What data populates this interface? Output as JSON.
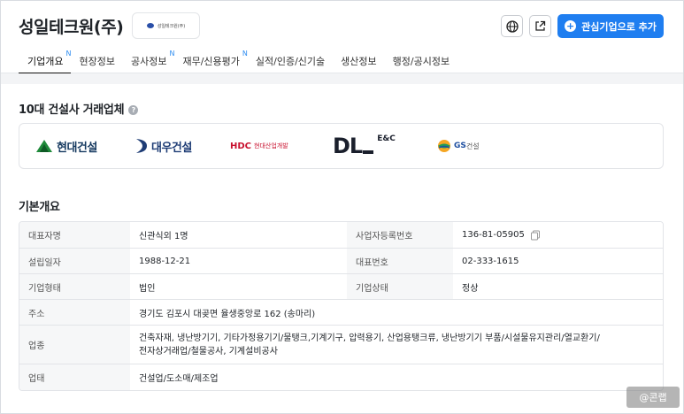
{
  "header": {
    "company_name": "성일테크원(주)",
    "logo_alt_text": "성일테크원(주)",
    "globe_icon": "globe-icon",
    "share_icon": "external-link-icon",
    "interest_button_label": "관심기업으로 추가"
  },
  "tabs": [
    {
      "label": "기업개요",
      "badge": "N",
      "active": true
    },
    {
      "label": "현장정보",
      "badge": "",
      "active": false
    },
    {
      "label": "공사정보",
      "badge": "N",
      "active": false
    },
    {
      "label": "재무/신용평가",
      "badge": "N",
      "active": false
    },
    {
      "label": "실적/인증/신기술",
      "badge": "",
      "active": false
    },
    {
      "label": "생산정보",
      "badge": "",
      "active": false
    },
    {
      "label": "행정/공시정보",
      "badge": "",
      "active": false
    }
  ],
  "partners_section": {
    "title": "10대 건설사 거래업체",
    "partners": [
      {
        "name": "현대건설"
      },
      {
        "name": "대우건설"
      },
      {
        "name": "HDC",
        "sub": "현대산업개발"
      },
      {
        "name": "DL",
        "sub": "E&C"
      },
      {
        "name": "GS",
        "sub": "건설"
      }
    ]
  },
  "overview": {
    "title": "기본개요",
    "rows": [
      {
        "label1": "대표자명",
        "value1": "신관식외 1명",
        "label2": "사업자등록번호",
        "value2": "136-81-05905"
      },
      {
        "label1": "설립일자",
        "value1": "1988-12-21",
        "label2": "대표번호",
        "value2": "02-333-1615"
      },
      {
        "label1": "기업형태",
        "value1": "법인",
        "label2": "기업상태",
        "value2": "정상"
      },
      {
        "label": "주소",
        "value": "경기도 김포시 대곶면 율생중앙로 162 (송마리)"
      },
      {
        "label": "업종",
        "value_line1": "건축자재, 냉난방기기, 기타가정용기기/물탱크,기계기구, 압력용기, 산업용탱크류, 냉난방기기 부품/시설물유지관리/열교환기/",
        "value_line2": "전자상거래업/철물공사, 기계설비공사"
      },
      {
        "label": "업태",
        "value": "건설업/도소매/제조업"
      }
    ]
  },
  "watermark": "@콘랩",
  "colors": {
    "accent": "#1f7ef0",
    "badge": "#2d8cf0",
    "hyundai": "#14385f",
    "hdc": "#c8102e"
  }
}
